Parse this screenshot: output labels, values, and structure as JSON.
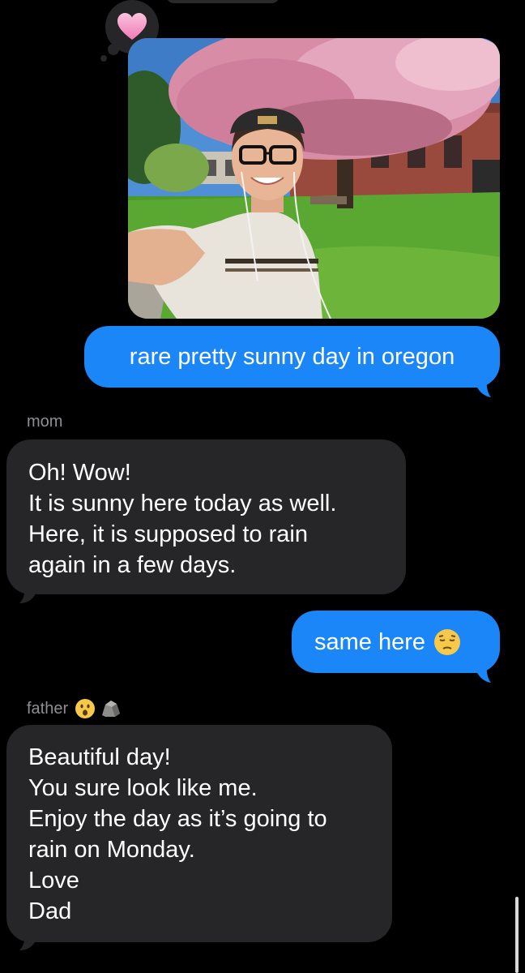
{
  "conversation": {
    "tapback_reaction": "heart-icon",
    "photo_alt": "selfie",
    "messages": [
      {
        "from": "me",
        "text": "rare pretty sunny day in oregon"
      },
      {
        "from": "mom",
        "sender_label": "mom",
        "lines": [
          "Oh! Wow!",
          "It is sunny here today as well.",
          "Here, it is supposed to rain",
          "again in a few days."
        ]
      },
      {
        "from": "me",
        "text": "same here",
        "emoji": "pensive-face-icon"
      },
      {
        "from": "father",
        "sender_label": "father",
        "sender_emojis": [
          "hushed-face-icon",
          "rock-icon"
        ],
        "lines": [
          "Beautiful day!",
          "You sure look like me.",
          "Enjoy the day as it’s going to",
          "rain on Monday.",
          "Love",
          "Dad"
        ]
      }
    ]
  },
  "colors": {
    "background": "#000000",
    "outgoing_bubble": "#1b86f7",
    "incoming_bubble": "#262628",
    "sender_label": "#8e8e93",
    "tapback_heart": "#f7a6cf"
  }
}
